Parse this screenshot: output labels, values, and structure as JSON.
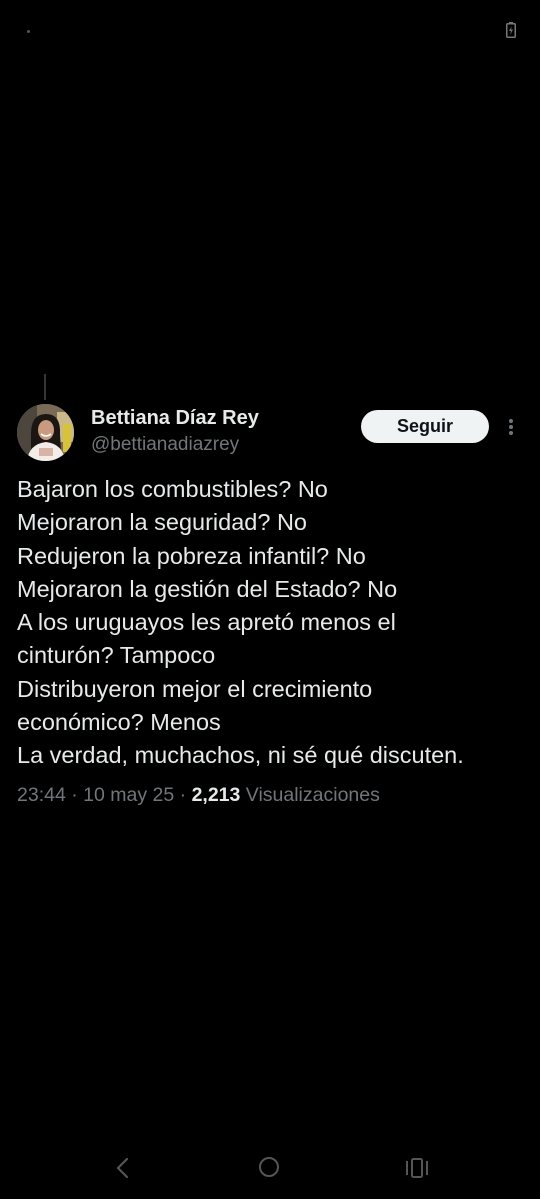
{
  "status_bar": {
    "battery_icon": "battery-charging-icon"
  },
  "tweet": {
    "author": {
      "display_name": "Bettiana Díaz Rey",
      "handle": "@bettianadiazrey",
      "avatar": "profile-photo"
    },
    "follow_label": "Seguir",
    "more_icon": "more-vertical-icon",
    "lines": [
      "Bajaron los combustibles? No",
      "Mejoraron la seguridad? No",
      "Redujeron la pobreza infantil? No",
      "Mejoraron la gestión del Estado? No",
      "A los uruguayos les apretó menos el",
      "cinturón? Tampoco",
      "Distribuyeron mejor el crecimiento",
      "económico? Menos",
      "La verdad, muchachos, ni sé qué discuten."
    ],
    "time": "23:44",
    "separator": "·",
    "date": "10 may 25",
    "views_count": "2,213",
    "views_label": "Visualizaciones"
  },
  "nav_bar": {
    "back_icon": "back-chevron-icon",
    "home_icon": "home-circle-icon",
    "recents_icon": "recents-icon"
  },
  "colors": {
    "background": "#000000",
    "text_primary": "#e7e9ea",
    "text_secondary": "#71767b",
    "button_bg": "#eff3f4",
    "button_text": "#0f1419"
  }
}
